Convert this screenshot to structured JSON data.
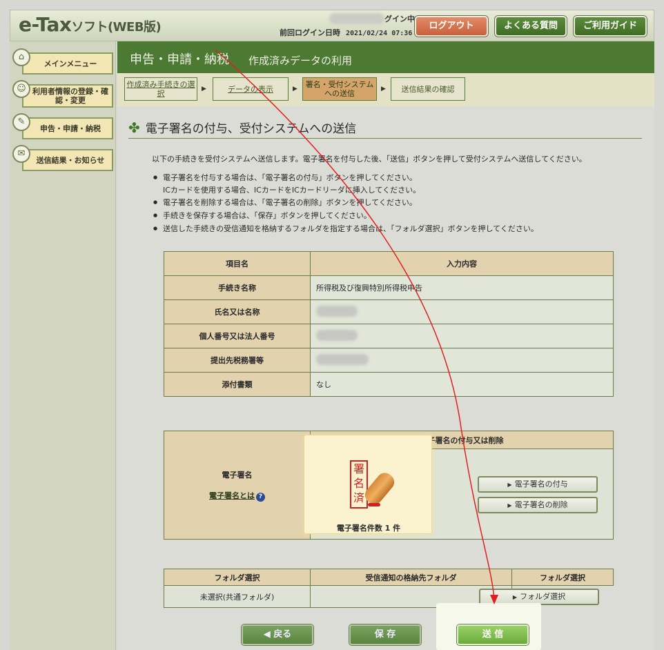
{
  "header": {
    "logo_main": "e-Tax",
    "logo_sub": "ソフト(WEB版)",
    "login_status": "グイン中",
    "last_login_label": "前回ログイン日時",
    "last_login_value": "2021/02/24 07:36",
    "logout_label": "ログアウト",
    "faq_label": "よくある質問",
    "guide_label": "ご利用ガイド"
  },
  "sidebar": {
    "items": [
      {
        "label": "メインメニュー",
        "icon": "home-icon"
      },
      {
        "label": "利用者情報の登録・確認・変更",
        "icon": "user-icon"
      },
      {
        "label": "申告・申請・納税",
        "icon": "document-icon"
      },
      {
        "label": "送信結果・お知らせ",
        "icon": "mail-icon"
      }
    ]
  },
  "main": {
    "title": "申告・申請・納税",
    "subtitle": "作成済みデータの利用",
    "steps": [
      {
        "label": "作成済み手続きの選択"
      },
      {
        "label": "データの表示"
      },
      {
        "label": "署名・受付システムへの送信"
      },
      {
        "label": "送信結果の確認"
      }
    ],
    "section_title": "電子署名の付与、受付システムへの送信",
    "intro": "以下の手続きを受付システムへ送信します。電子署名を付与した後、「送信」ボタンを押して受付システムへ送信してください。",
    "bullets": [
      "電子署名を付与する場合は、「電子署名の付与」ボタンを押してください。",
      "ICカードを使用する場合、ICカードをICカードリーダに挿入してください。",
      "電子署名を削除する場合は、「電子署名の削除」ボタンを押してください。",
      "手続きを保存する場合は、「保存」ボタンを押してください。",
      "送信した手続きの受信通知を格納するフォルダを指定する場合は、「フォルダ選択」ボタンを押してください。"
    ]
  },
  "info_table": {
    "headers": [
      "項目名",
      "入力内容"
    ],
    "rows": [
      {
        "label": "手続き名称",
        "value": "所得税及び復興特別所得税申告"
      },
      {
        "label": "氏名又は名称",
        "value": ""
      },
      {
        "label": "個人番号又は法人番号",
        "value": ""
      },
      {
        "label": "提出先税務署等",
        "value": ""
      },
      {
        "label": "添付書類",
        "value": "なし"
      }
    ]
  },
  "signature": {
    "row_label": "電子署名",
    "link_label": "電子署名とは",
    "help_icon": "?",
    "header": "電子署名の付与又は削除",
    "stamp_text": "署名済",
    "count_text": "電子署名件数 1 件",
    "add_label": "電子署名の付与",
    "delete_label": "電子署名の削除"
  },
  "folder": {
    "row_label": "フォルダ選択",
    "headers": [
      "受信通知の格納先フォルダ",
      "フォルダ選択"
    ],
    "value": "未選択(共通フォルダ)",
    "button_label": "フォルダ選択"
  },
  "bottom": {
    "back_label": "戻る",
    "save_label": "保 存",
    "send_label": "送 信"
  },
  "colors": {
    "title_green": "#4d7a33",
    "table_header": "#e2d2ae",
    "annotation_red": "#e02020"
  }
}
